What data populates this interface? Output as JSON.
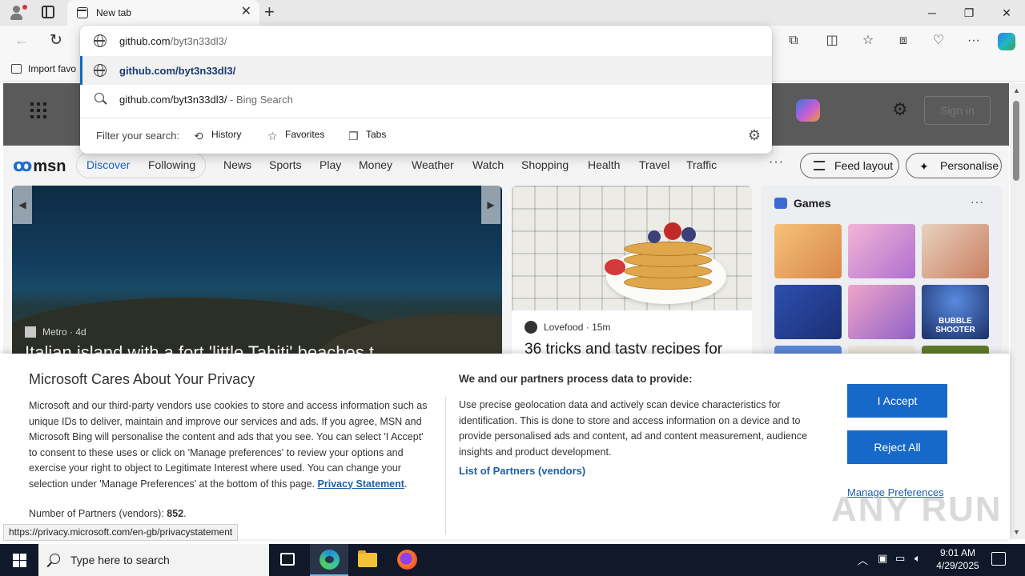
{
  "browser": {
    "tab_title": "New tab",
    "close_tab": "✕",
    "new_tab": "+",
    "minimize": "─",
    "restore": "❐",
    "close": "✕",
    "back": "←",
    "reload": "↻",
    "favorites_import": "Import favo"
  },
  "omnibox": {
    "url_typed": "github.com",
    "url_suggest": "/byt3n33dl3/",
    "suggestion_url": "github.com/byt3n33dl3/",
    "search_query": "github.com/byt3n33dl3/",
    "search_suffix": " - Bing Search",
    "filter_label": "Filter your search:",
    "filters": {
      "history": "History",
      "favorites": "Favorites",
      "tabs": "Tabs"
    }
  },
  "msn": {
    "logo": "msn",
    "sign_in": "Sign in",
    "nav": {
      "discover": "Discover",
      "following": "Following",
      "news": "News",
      "sports": "Sports",
      "play": "Play",
      "money": "Money",
      "weather": "Weather",
      "watch": "Watch",
      "shopping": "Shopping",
      "health": "Health",
      "travel": "Travel",
      "traffic": "Traffic",
      "more": "···",
      "feed_layout": "Feed layout",
      "personalise": "Personalise"
    },
    "hero": {
      "source": "Metro",
      "age": "4d",
      "title": "Italian island with a fort 'little Tahiti' beaches t"
    },
    "card2": {
      "source": "Lovefood",
      "age": "15m",
      "title": "36 tricks and tasty recipes for"
    },
    "games": {
      "title": "Games",
      "more": "···",
      "tile_bubble": "BUBBLE SHOOTER"
    }
  },
  "privacy": {
    "title": "Microsoft Cares About Your Privacy",
    "body": "Microsoft and our third-party vendors use cookies to store and access information such as unique IDs to deliver, maintain and improve our services and ads. If you agree, MSN and Microsoft Bing will personalise the content and ads that you see. You can select 'I Accept' to consent to these uses or click on 'Manage preferences' to review your options and exercise your right to object to Legitimate Interest where used.  You can change your selection under 'Manage Preferences' at the bottom of this page. ",
    "privacy_link": "Privacy Statement",
    "partners_label": "Number of Partners (vendors): ",
    "partners_count": "852",
    "process_title": "We and our partners process data to provide:",
    "process_body": "Use precise geolocation data and actively scan device characteristics for identification. This is done to store and access information on a device and to provide personalised ads and content, ad and content measurement, audience insights and product development.",
    "partners_link": "List of Partners (vendors)",
    "accept": "I Accept",
    "reject": "Reject All",
    "manage": "Manage Preferences",
    "watermark": "ANY RUN"
  },
  "status_url": "https://privacy.microsoft.com/en-gb/privacystatement",
  "taskbar": {
    "search_placeholder": "Type here to search",
    "time": "9:01 AM",
    "date": "4/29/2025"
  }
}
